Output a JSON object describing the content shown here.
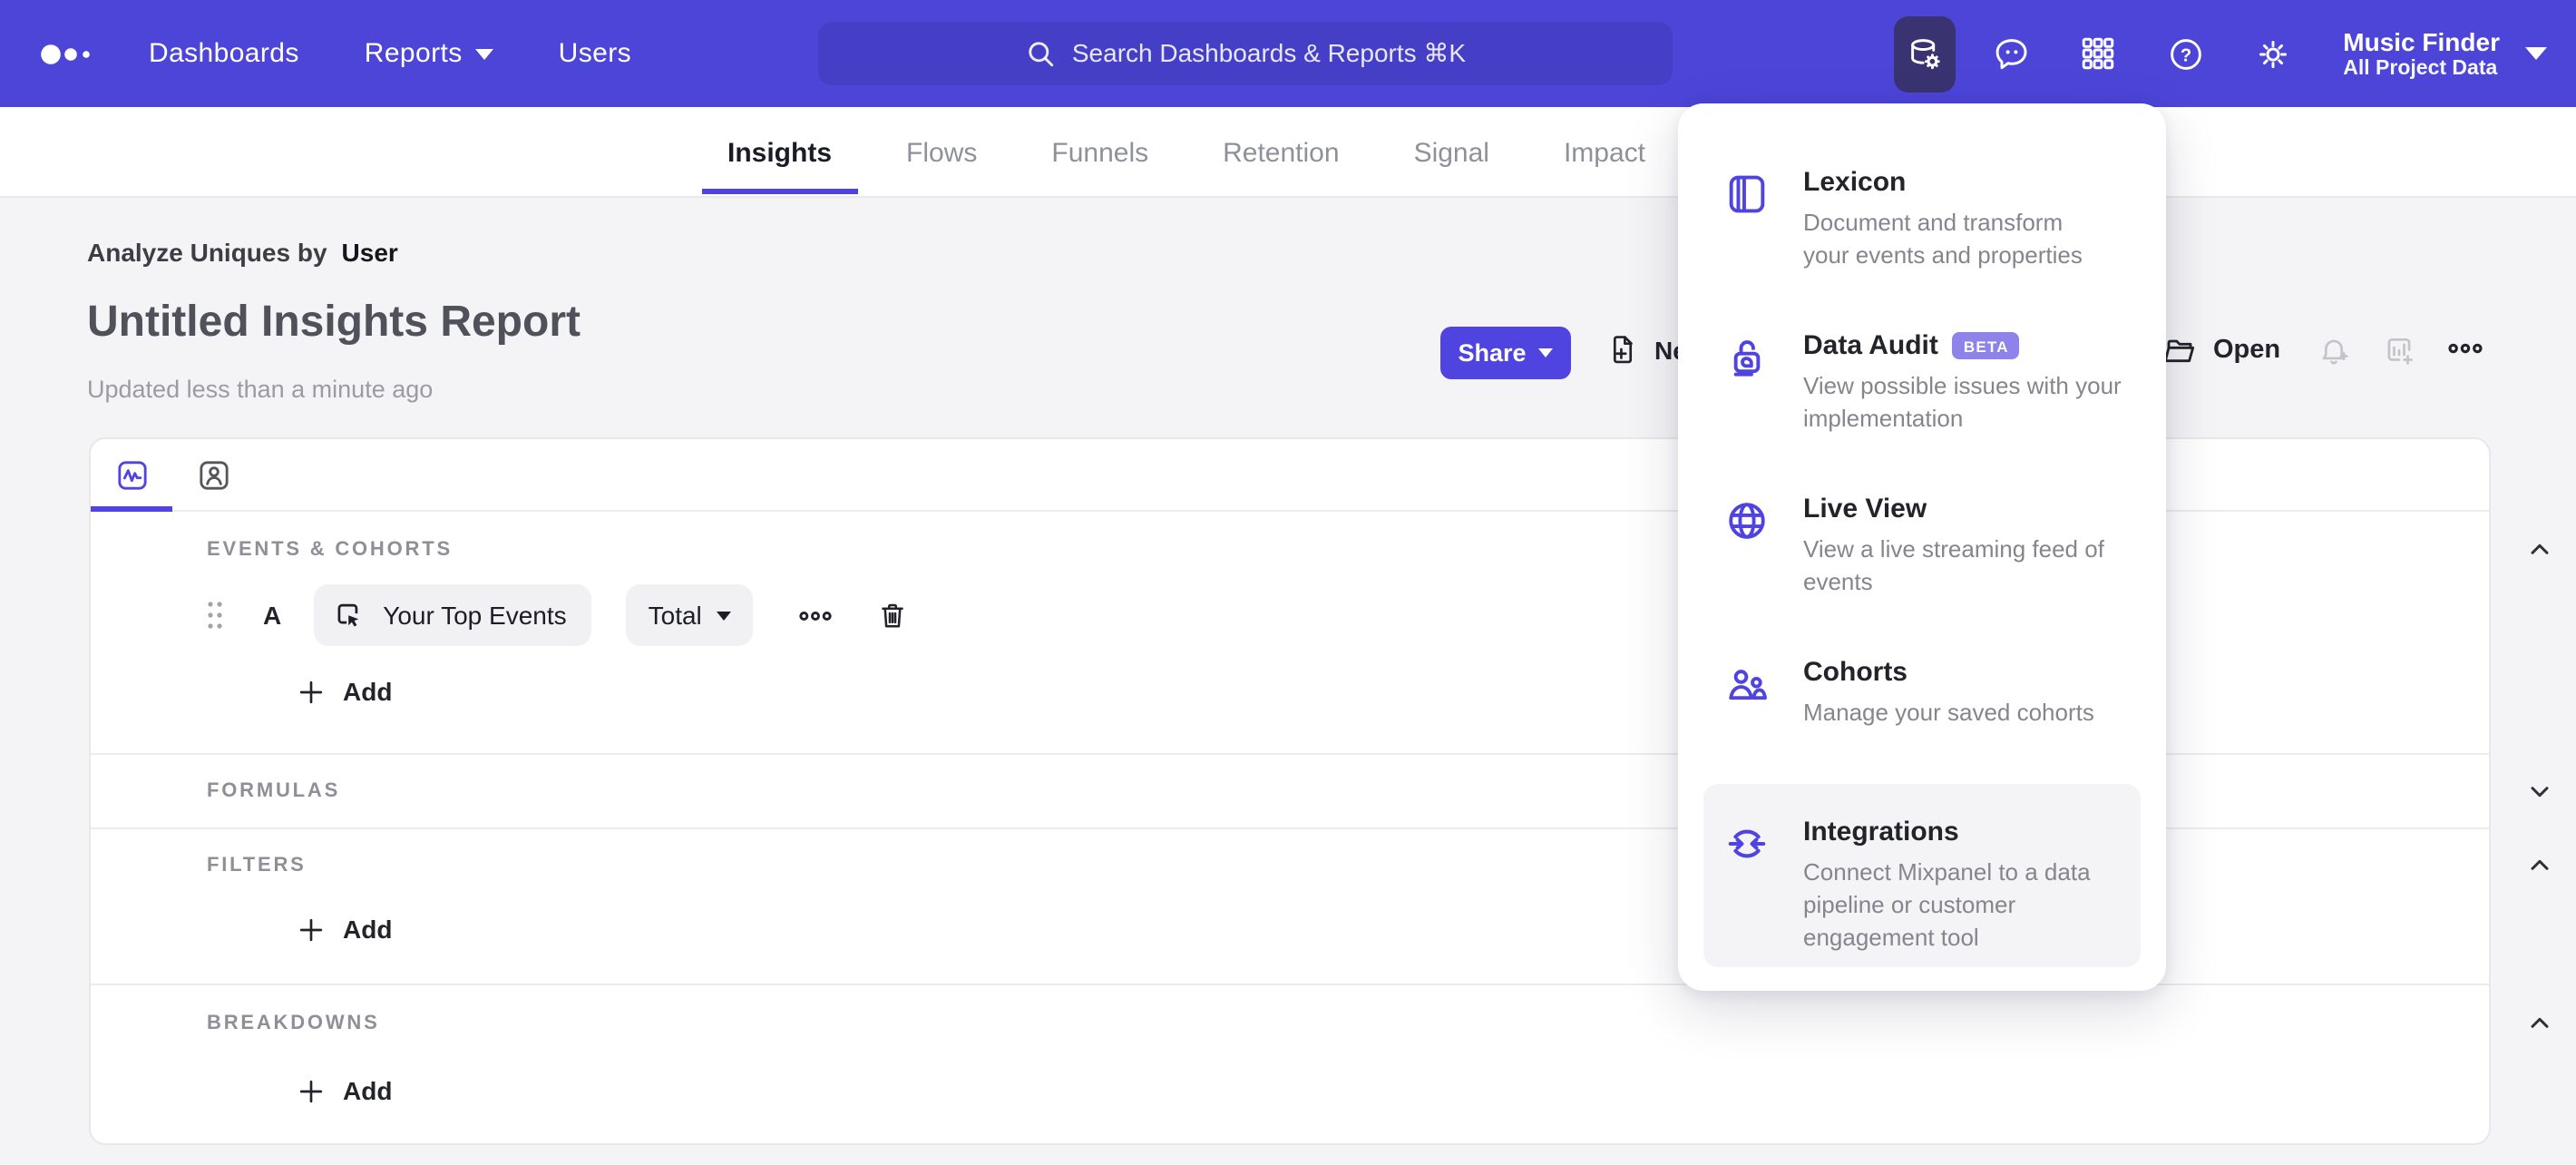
{
  "nav": {
    "items": [
      {
        "label": "Dashboards"
      },
      {
        "label": "Reports"
      },
      {
        "label": "Users"
      }
    ],
    "search_placeholder": "Search Dashboards & Reports ⌘K",
    "project": {
      "name": "Music Finder",
      "scope": "All Project Data"
    }
  },
  "tabs": [
    {
      "label": "Insights"
    },
    {
      "label": "Flows"
    },
    {
      "label": "Funnels"
    },
    {
      "label": "Retention"
    },
    {
      "label": "Signal"
    },
    {
      "label": "Impact"
    }
  ],
  "report": {
    "analyze_prefix": "Analyze Uniques by",
    "analyze_value": "User",
    "title": "Untitled Insights Report",
    "updated": "Updated less than a minute ago"
  },
  "actions": {
    "share": "Share",
    "new_report": "New Report",
    "open": "Open"
  },
  "builder": {
    "sections": {
      "events": "EVENTS & COHORTS",
      "formulas": "FORMULAS",
      "filters": "FILTERS",
      "breakdowns": "BREAKDOWNS"
    },
    "event_row": {
      "letter": "A",
      "event": "Your Top Events",
      "metric": "Total"
    },
    "add_label": "Add"
  },
  "menu": {
    "items": [
      {
        "title": "Lexicon",
        "desc": "Document and transform\nyour events and properties"
      },
      {
        "title": "Data Audit",
        "badge": "BETA",
        "desc": "View possible issues with your\nimplementation"
      },
      {
        "title": "Live View",
        "desc": "View a live streaming feed of\nevents"
      },
      {
        "title": "Cohorts",
        "desc": "Manage your saved cohorts"
      },
      {
        "title": "Integrations",
        "desc": "Connect Mixpanel to a data\npipeline or customer\nengagement tool"
      }
    ]
  },
  "colors": {
    "nav_purple": "#4c45d8",
    "accent_purple": "#4f44e0",
    "active_tile": "#393372",
    "badge_purple": "#8d83ea",
    "page_bg": "#f4f4f6"
  }
}
